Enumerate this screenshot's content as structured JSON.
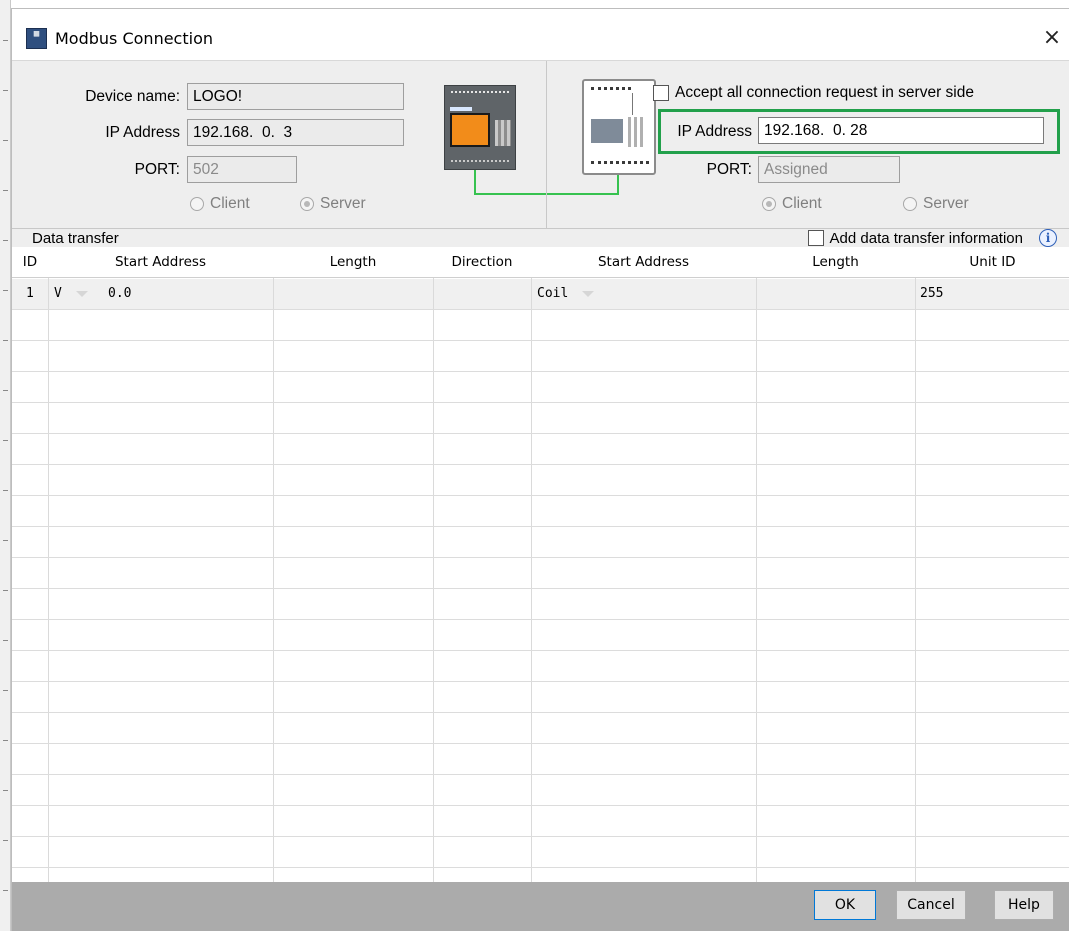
{
  "window": {
    "title": "Modbus Connection",
    "close_glyph": "×",
    "icon": "logo-app-icon"
  },
  "local": {
    "device_name_label": "Device name:",
    "device_name_value": "LOGO!",
    "ip_label": "IP Address",
    "ip_value": "192.168.  0.  3",
    "port_label": "PORT:",
    "port_value": "502",
    "client_label": "Client",
    "server_label": "Server",
    "selected_mode": "Server"
  },
  "remote": {
    "accept_all_label": "Accept all connection request in server side",
    "accept_all_checked": false,
    "ip_label": "IP Address",
    "ip_value": "192.168.  0. 28",
    "port_label": "PORT:",
    "port_value": "Assigned",
    "client_label": "Client",
    "server_label": "Server",
    "selected_mode": "Client",
    "highlight_color": "#22a04b"
  },
  "data_transfer": {
    "title": "Data transfer",
    "add_info_label": "Add data transfer information",
    "add_info_checked": false,
    "info_icon_glyph": "i",
    "columns": [
      "ID",
      "Start Address",
      "Length",
      "Direction",
      "Start Address",
      "Length",
      "Unit ID"
    ],
    "rows": [
      {
        "id": "1",
        "local_area": "V",
        "local_start": "0.0",
        "length": "",
        "direction": "",
        "remote_area": "Coil",
        "remote_length": "",
        "unit_id": "255"
      }
    ]
  },
  "footer": {
    "ok_label": "OK",
    "cancel_label": "Cancel",
    "help_label": "Help"
  },
  "colors": {
    "panel": "#eeeeee",
    "footer": "#ababab",
    "connector": "#36c24f",
    "logo_screen": "#f28c1a"
  }
}
